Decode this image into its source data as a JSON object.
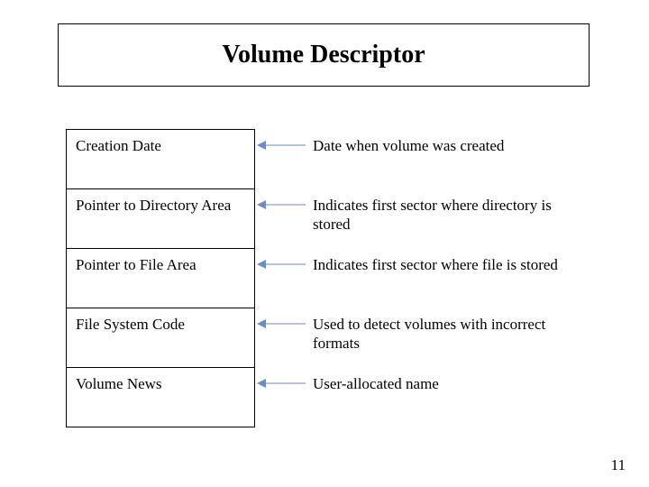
{
  "title": "Volume Descriptor",
  "rows": [
    {
      "field": "Creation Date",
      "desc": "Date when volume was created"
    },
    {
      "field": "Pointer to Directory Area",
      "desc": "Indicates first sector where directory is stored"
    },
    {
      "field": "Pointer to File Area",
      "desc": "Indicates first sector where file is stored"
    },
    {
      "field": "File System Code",
      "desc": "Used to detect volumes with incorrect formats"
    },
    {
      "field": "Volume News",
      "desc": "User-allocated name"
    }
  ],
  "page_number": "11",
  "arrow_color": "#6a8cc7"
}
